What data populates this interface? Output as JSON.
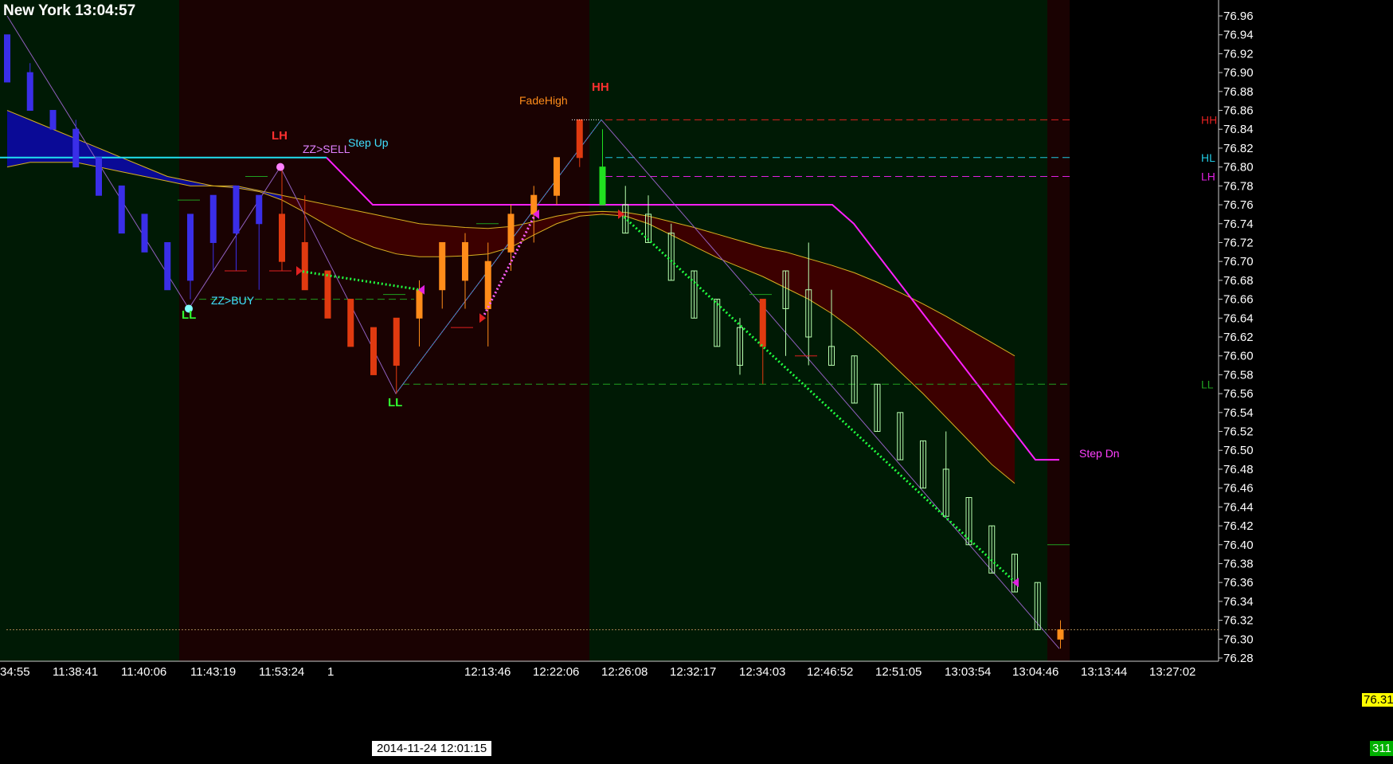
{
  "clock": "New York 13:04:57",
  "date_label": "2014-11-24",
  "colors": {
    "background": "#000000",
    "session_green": "#001a05",
    "session_red": "#1a0202",
    "up_candle_blue": "#3a2ee8",
    "up_candle_orange": "#ff8c1a",
    "down_candle_red": "#e03a10",
    "green_candle": "#b8ffb0",
    "band_blue": "#0a0a96",
    "band_red": "#3c0000",
    "band_edge": "#d8b020",
    "step_line": "#ff20ff",
    "step_up_line": "#20e0f0",
    "hh_line": "#e02020",
    "ll_line": "#20a020",
    "lh_line": "#e020e0",
    "green_dots": "#20ff40",
    "pink_dots": "#ff60ff"
  },
  "chart_data": {
    "type": "candlestick",
    "ylim": [
      76.28,
      76.96
    ],
    "y_ticks": [
      "76.96",
      "76.94",
      "76.92",
      "76.90",
      "76.88",
      "76.86",
      "76.84",
      "76.82",
      "76.80",
      "76.78",
      "76.76",
      "76.74",
      "76.72",
      "76.70",
      "76.68",
      "76.66",
      "76.64",
      "76.62",
      "76.60",
      "76.58",
      "76.56",
      "76.54",
      "76.52",
      "76.50",
      "76.48",
      "76.46",
      "76.44",
      "76.42",
      "76.40",
      "76.38",
      "76.36",
      "76.34",
      "76.32",
      "76.30",
      "76.28"
    ],
    "x_ticks": [
      "34:55",
      "11:38:41",
      "11:40:06",
      "11:43:19",
      "11:53:24",
      "1",
      "12:13:46",
      "12:22:06",
      "12:26:08",
      "12:32:17",
      "12:34:03",
      "12:46:52",
      "12:51:05",
      "13:03:54",
      "13:04:46",
      "13:13:44",
      "13:27:02"
    ],
    "x_tick_date_label": "2014-11-24  12:01:15",
    "current_price": "76.31",
    "corner_badge": "311",
    "candles": [
      {
        "o": 76.89,
        "h": 76.94,
        "l": 76.89,
        "c": 76.94,
        "k": "blue"
      },
      {
        "o": 76.86,
        "h": 76.91,
        "l": 76.86,
        "c": 76.9,
        "k": "blue"
      },
      {
        "o": 76.84,
        "h": 76.86,
        "l": 76.84,
        "c": 76.86,
        "k": "blue"
      },
      {
        "o": 76.8,
        "h": 76.85,
        "l": 76.8,
        "c": 76.84,
        "k": "blue"
      },
      {
        "o": 76.77,
        "h": 76.81,
        "l": 76.77,
        "c": 76.81,
        "k": "blue"
      },
      {
        "o": 76.73,
        "h": 76.78,
        "l": 76.73,
        "c": 76.78,
        "k": "blue"
      },
      {
        "o": 76.71,
        "h": 76.75,
        "l": 76.71,
        "c": 76.75,
        "k": "blue"
      },
      {
        "o": 76.67,
        "h": 76.72,
        "l": 76.67,
        "c": 76.72,
        "k": "blue"
      },
      {
        "o": 76.68,
        "h": 76.75,
        "l": 76.66,
        "c": 76.75,
        "k": "blue"
      },
      {
        "o": 76.72,
        "h": 76.77,
        "l": 76.69,
        "c": 76.77,
        "k": "blue"
      },
      {
        "o": 76.73,
        "h": 76.78,
        "l": 76.69,
        "c": 76.78,
        "k": "blue"
      },
      {
        "o": 76.74,
        "h": 76.77,
        "l": 76.67,
        "c": 76.77,
        "k": "blue"
      },
      {
        "o": 76.75,
        "h": 76.8,
        "l": 76.69,
        "c": 76.7,
        "k": "red"
      },
      {
        "o": 76.72,
        "h": 76.77,
        "l": 76.67,
        "c": 76.67,
        "k": "red"
      },
      {
        "o": 76.69,
        "h": 76.69,
        "l": 76.64,
        "c": 76.64,
        "k": "red"
      },
      {
        "o": 76.66,
        "h": 76.66,
        "l": 76.61,
        "c": 76.61,
        "k": "red"
      },
      {
        "o": 76.63,
        "h": 76.63,
        "l": 76.58,
        "c": 76.58,
        "k": "red"
      },
      {
        "o": 76.64,
        "h": 76.64,
        "l": 76.56,
        "c": 76.59,
        "k": "red"
      },
      {
        "o": 76.64,
        "h": 76.68,
        "l": 76.61,
        "c": 76.67,
        "k": "orange"
      },
      {
        "o": 76.67,
        "h": 76.72,
        "l": 76.65,
        "c": 76.72,
        "k": "orange"
      },
      {
        "o": 76.68,
        "h": 76.73,
        "l": 76.65,
        "c": 76.72,
        "k": "orange"
      },
      {
        "o": 76.65,
        "h": 76.72,
        "l": 76.61,
        "c": 76.7,
        "k": "orange"
      },
      {
        "o": 76.71,
        "h": 76.76,
        "l": 76.69,
        "c": 76.75,
        "k": "orange"
      },
      {
        "o": 76.75,
        "h": 76.78,
        "l": 76.72,
        "c": 76.77,
        "k": "orange"
      },
      {
        "o": 76.77,
        "h": 76.81,
        "l": 76.76,
        "c": 76.81,
        "k": "orange"
      },
      {
        "o": 76.81,
        "h": 76.85,
        "l": 76.8,
        "c": 76.85,
        "k": "red"
      },
      {
        "o": 76.8,
        "h": 76.84,
        "l": 76.76,
        "c": 76.76,
        "k": "green"
      },
      {
        "o": 76.76,
        "h": 76.78,
        "l": 76.73,
        "c": 76.73,
        "k": "white"
      },
      {
        "o": 76.75,
        "h": 76.77,
        "l": 76.72,
        "c": 76.72,
        "k": "white"
      },
      {
        "o": 76.73,
        "h": 76.74,
        "l": 76.68,
        "c": 76.68,
        "k": "white"
      },
      {
        "o": 76.69,
        "h": 76.69,
        "l": 76.64,
        "c": 76.64,
        "k": "white"
      },
      {
        "o": 76.66,
        "h": 76.66,
        "l": 76.61,
        "c": 76.61,
        "k": "white"
      },
      {
        "o": 76.63,
        "h": 76.64,
        "l": 76.58,
        "c": 76.59,
        "k": "white"
      },
      {
        "o": 76.66,
        "h": 76.66,
        "l": 76.57,
        "c": 76.61,
        "k": "red"
      },
      {
        "o": 76.69,
        "h": 76.69,
        "l": 76.6,
        "c": 76.65,
        "k": "white"
      },
      {
        "o": 76.67,
        "h": 76.72,
        "l": 76.59,
        "c": 76.62,
        "k": "white"
      },
      {
        "o": 76.61,
        "h": 76.67,
        "l": 76.59,
        "c": 76.59,
        "k": "white"
      },
      {
        "o": 76.6,
        "h": 76.6,
        "l": 76.55,
        "c": 76.55,
        "k": "white"
      },
      {
        "o": 76.57,
        "h": 76.57,
        "l": 76.52,
        "c": 76.52,
        "k": "white"
      },
      {
        "o": 76.54,
        "h": 76.54,
        "l": 76.49,
        "c": 76.49,
        "k": "white"
      },
      {
        "o": 76.51,
        "h": 76.51,
        "l": 76.46,
        "c": 76.46,
        "k": "white"
      },
      {
        "o": 76.48,
        "h": 76.52,
        "l": 76.43,
        "c": 76.43,
        "k": "white"
      },
      {
        "o": 76.45,
        "h": 76.45,
        "l": 76.4,
        "c": 76.4,
        "k": "white"
      },
      {
        "o": 76.42,
        "h": 76.42,
        "l": 76.37,
        "c": 76.37,
        "k": "white"
      },
      {
        "o": 76.39,
        "h": 76.39,
        "l": 76.35,
        "c": 76.35,
        "k": "white"
      },
      {
        "o": 76.36,
        "h": 76.36,
        "l": 76.31,
        "c": 76.31,
        "k": "white"
      },
      {
        "o": 76.3,
        "h": 76.32,
        "l": 76.29,
        "c": 76.31,
        "k": "orange"
      }
    ],
    "horizontal_levels": [
      {
        "name": "HH",
        "price": 76.85,
        "color": "#e02020"
      },
      {
        "name": "HL",
        "price": 76.81,
        "color": "#20c8e0"
      },
      {
        "name": "LH",
        "price": 76.79,
        "color": "#e020e0"
      },
      {
        "name": "LL",
        "price": 76.57,
        "color": "#20a020"
      }
    ],
    "labels": {
      "fade_high": "FadeHigh",
      "hh": "HH",
      "lh": "LH",
      "ll_left": "LL",
      "ll_mid": "LL",
      "zz_sell": "ZZ>SELL",
      "zz_buy": "ZZ>BUY",
      "step_up": "Step Up",
      "step_dn": "Step Dn"
    }
  }
}
